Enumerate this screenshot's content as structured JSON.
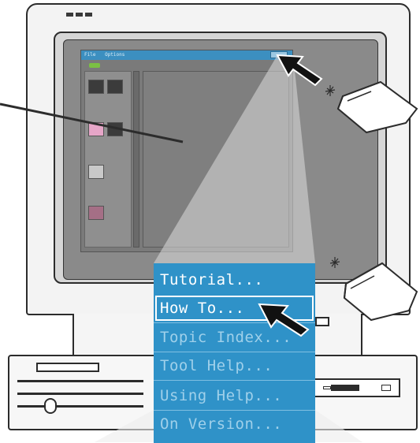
{
  "app_window": {
    "title_items": [
      "File",
      "Options"
    ]
  },
  "help_menu": {
    "items": [
      {
        "label": "Tutorial...",
        "state": "enabled"
      },
      {
        "label": "How To...",
        "state": "selected"
      },
      {
        "label": "Topic Index...",
        "state": "disabled"
      },
      {
        "label": "Tool Help...",
        "state": "disabled"
      },
      {
        "label": "Using Help...",
        "state": "disabled"
      },
      {
        "label": "On Version...",
        "state": "disabled"
      }
    ]
  },
  "icons": {
    "pointer": "arrow-pointer-icon",
    "mouse": "mouse-click-icon"
  },
  "colors": {
    "menu_background": "#2f92c8",
    "menu_text": "#ffffff",
    "menu_text_disabled": "#9fd0ea",
    "title_bar": "#3c8fc0"
  }
}
